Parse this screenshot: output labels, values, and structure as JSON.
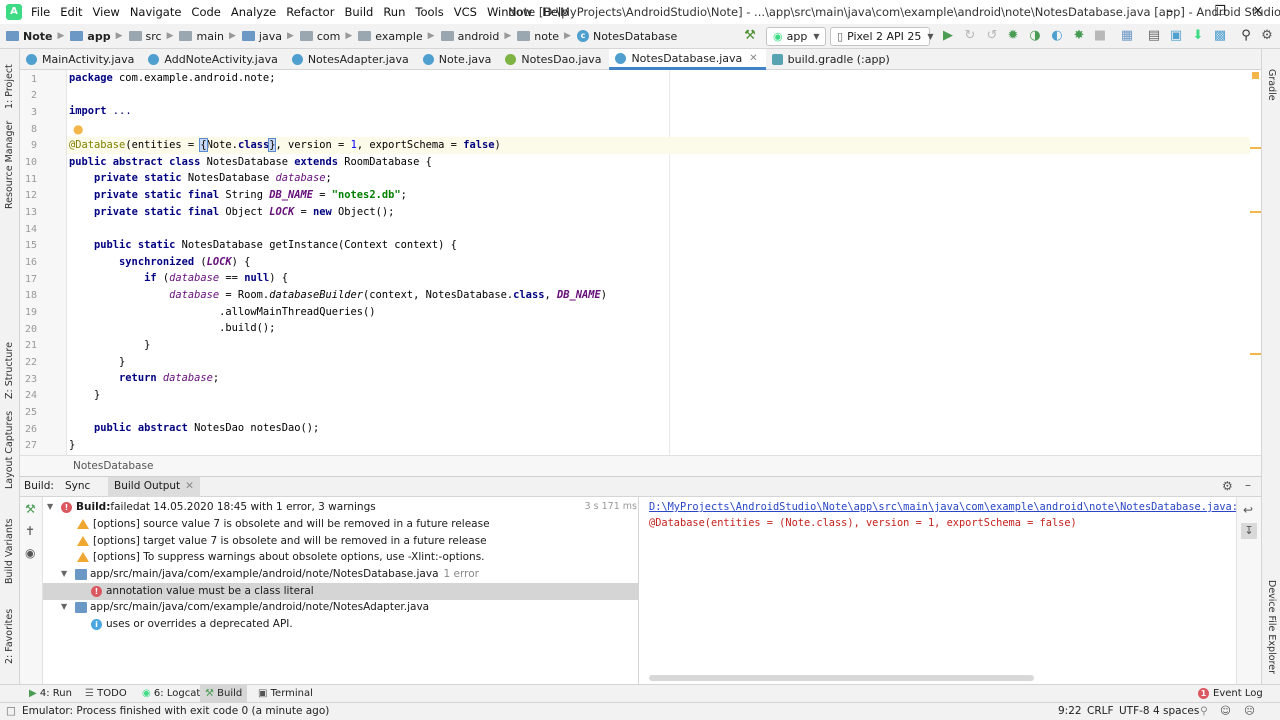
{
  "menu": {
    "items": [
      "File",
      "Edit",
      "View",
      "Navigate",
      "Code",
      "Analyze",
      "Refactor",
      "Build",
      "Run",
      "Tools",
      "VCS",
      "Window",
      "Help"
    ]
  },
  "window_title": "Note [D:\\MyProjects\\AndroidStudio\\Note] - ...\\app\\src\\main\\java\\com\\example\\android\\note\\NotesDatabase.java [app] - Android Studio",
  "breadcrumbs": [
    "Note",
    "app",
    "src",
    "main",
    "java",
    "com",
    "example",
    "android",
    "note",
    "NotesDatabase"
  ],
  "run_config": "app",
  "device": "Pixel 2 API 25",
  "left_tool_tabs": {
    "project": "1: Project",
    "resource_manager": "Resource Manager",
    "structure": "Z: Structure",
    "layout_captures": "Layout Captures",
    "build_variants": "Build Variants",
    "favorites": "2: Favorites"
  },
  "right_tool_tabs": {
    "gradle": "Gradle",
    "device_file_explorer": "Device File Explorer"
  },
  "editor_tabs": [
    {
      "label": "MainActivity.java",
      "icon": "class-icon"
    },
    {
      "label": "AddNoteActivity.java",
      "icon": "class-icon"
    },
    {
      "label": "NotesAdapter.java",
      "icon": "class-icon"
    },
    {
      "label": "Note.java",
      "icon": "class-icon"
    },
    {
      "label": "NotesDao.java",
      "icon": "interface-icon"
    },
    {
      "label": "NotesDatabase.java",
      "icon": "class-icon",
      "active": true
    },
    {
      "label": "build.gradle (:app)",
      "icon": "gradle-icon"
    }
  ],
  "line_numbers": [
    "1",
    "2",
    "3",
    "8",
    "9",
    "10",
    "11",
    "12",
    "13",
    "14",
    "15",
    "16",
    "17",
    "18",
    "19",
    "20",
    "21",
    "22",
    "23",
    "24",
    "25",
    "26",
    "27"
  ],
  "code": {
    "l1_pkg": "package",
    "l1_rest": " com.example.android.note;",
    "l3_import": "import",
    "l3_rest": " ...",
    "l9_annotation": "@Database",
    "l9_a": "(entities = ",
    "l9_caret": "{",
    "l9_b": "Note.",
    "l9_class": "class",
    "l9_close": "}",
    "l9_c": ", version = ",
    "l9_num": "1",
    "l9_d": ", exportSchema = ",
    "l9_false": "false",
    "l9_e": ")",
    "l10_kw": "public abstract class",
    "l10_a": " NotesDatabase ",
    "l10_ext": "extends",
    "l10_b": " RoomDatabase {",
    "l11_kw": "private static",
    "l11_a": " NotesDatabase ",
    "l11_fld": "database",
    "l11_b": ";",
    "l12_kw": "private static final",
    "l12_a": " String ",
    "l12_fld": "DB_NAME",
    "l12_b": " = ",
    "l12_str": "\"notes2.db\"",
    "l12_c": ";",
    "l13_kw": "private static final",
    "l13_a": " Object ",
    "l13_fld": "LOCK",
    "l13_b": " = ",
    "l13_new": "new",
    "l13_c": " Object();",
    "l15_kw": "public static",
    "l15_a": " NotesDatabase getInstance(Context context) {",
    "l16_kw": "synchronized",
    "l16_a": " (",
    "l16_fld": "LOCK",
    "l16_b": ") {",
    "l17_kw": "if",
    "l17_a": " (",
    "l17_fld": "database",
    "l17_b": " == ",
    "l17_null": "null",
    "l17_c": ") {",
    "l18_fld": "database",
    "l18_a": " = Room.",
    "l18_method": "databaseBuilder",
    "l18_b": "(context, NotesDatabase.",
    "l18_class": "class",
    "l18_c": ", ",
    "l18_fld2": "DB_NAME",
    "l18_d": ")",
    "l19": ".allowMainThreadQueries()",
    "l20": ".build();",
    "l21": "}",
    "l22": "}",
    "l23_kw": "return",
    "l23_a": " ",
    "l23_fld": "database",
    "l23_b": ";",
    "l24": "}",
    "l26_kw": "public abstract",
    "l26_a": " NotesDao notesDao();",
    "l27": "}"
  },
  "editor_breadcrumb": "NotesDatabase",
  "build_window": {
    "label": "Build:",
    "tabs": [
      "Sync",
      "Build Output"
    ],
    "summary_bold": "Build:",
    "summary_status": " failed",
    "summary_rest": " at 14.05.2020 18:45 with 1 error, 3 warnings",
    "duration": "3 s 171 ms",
    "warnings": [
      "[options] source value 7 is obsolete and will be removed in a future release",
      "[options] target value 7 is obsolete and will be removed in a future release",
      "[options] To suppress warnings about obsolete options, use -Xlint:-options."
    ],
    "file1": "app/src/main/java/com/example/android/note/NotesDatabase.java",
    "file1_count": "1 error",
    "error1": "annotation value must be a class literal",
    "file2": "app/src/main/java/com/example/android/note/NotesAdapter.java",
    "info1": "uses or overrides a deprecated API.",
    "console_link": "D:\\MyProjects\\AndroidStudio\\Note\\app\\src\\main\\java\\com\\example\\android\\note\\NotesDatabase.java:9:",
    "console_error": "@Database(entities = (Note.class), version = 1, exportSchema = false)"
  },
  "bottom_tabs": {
    "run": "4: Run",
    "todo": "TODO",
    "logcat": "6: Logcat",
    "build": "Build",
    "terminal": "Terminal",
    "event_log": "Event Log"
  },
  "status": {
    "message": "Emulator: Process finished with exit code 0 (a minute ago)",
    "position": "9:22",
    "line_sep": "CRLF",
    "encoding": "UTF-8",
    "indent": "4 spaces"
  },
  "colors": {
    "accent": "#4083c9",
    "error": "#db5860",
    "warning": "#f0a732",
    "android_green": "#3ddc84"
  }
}
